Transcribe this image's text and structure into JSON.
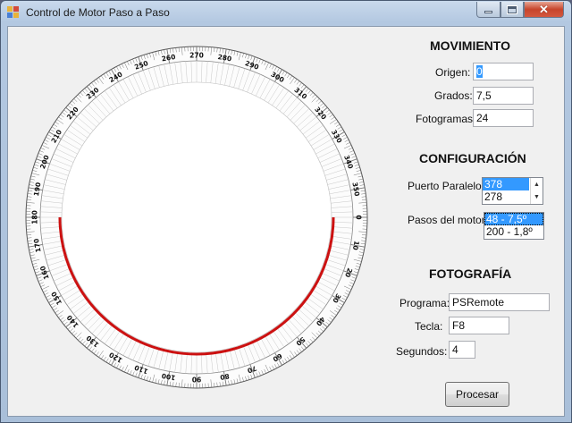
{
  "window": {
    "title": "Control de Motor Paso a Paso",
    "icon": "app-window-icon"
  },
  "dial": {
    "labels": [
      "0",
      "10",
      "20",
      "30",
      "40",
      "50",
      "60",
      "70",
      "80",
      "90",
      "100",
      "110",
      "120",
      "130",
      "140",
      "150",
      "160",
      "170",
      "180",
      "190",
      "200",
      "210",
      "220",
      "230",
      "240",
      "250",
      "260",
      "270",
      "280",
      "290",
      "300",
      "310",
      "320",
      "330",
      "340",
      "350"
    ],
    "arc": {
      "from_deg": 0,
      "to_deg": 180,
      "color": "#cc1111"
    }
  },
  "movimiento": {
    "title": "MOVIMIENTO",
    "origen_label": "Origen:",
    "origen_value": "0",
    "grados_label": "Grados:",
    "grados_value": "7,5",
    "fotogramas_label": "Fotogramas:",
    "fotogramas_value": "24"
  },
  "configuracion": {
    "title": "CONFIGURACIÓN",
    "puerto_label": "Puerto Paralelo:",
    "puerto_options": [
      "378",
      "278"
    ],
    "pasos_label": "Pasos del motor:",
    "pasos_options": [
      "48 - 7,5º",
      "200 - 1,8º"
    ]
  },
  "fotografia": {
    "title": "FOTOGRAFÍA",
    "programa_label": "Programa:",
    "programa_value": "PSRemote",
    "tecla_label": "Tecla:",
    "tecla_value": "F8",
    "segundos_label": "Segundos:",
    "segundos_value": "4"
  },
  "actions": {
    "procesar_label": "Procesar"
  }
}
